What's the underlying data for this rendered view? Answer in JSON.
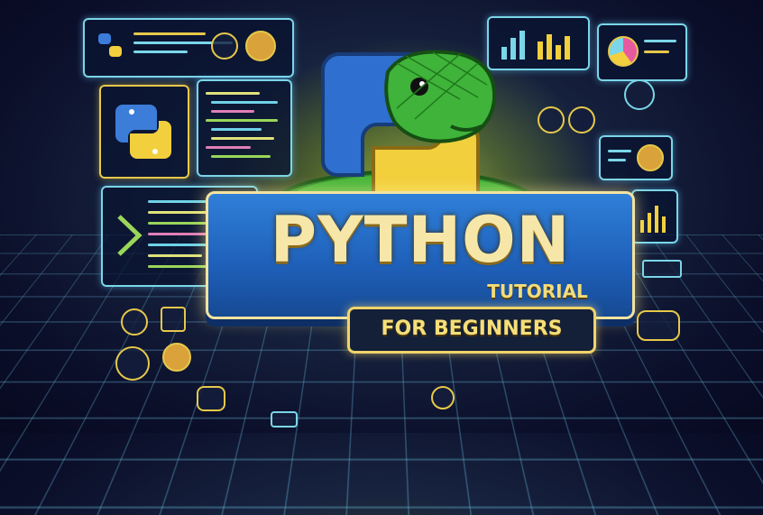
{
  "title": "PYTHON",
  "subtitle": "TUTORIAL",
  "banner": "FOR BEGINNERS",
  "icons": [
    "python-logo-icon",
    "snake-icon",
    "magnifier-icon",
    "bulb-icon",
    "chart-icon",
    "code-icon"
  ],
  "colors": {
    "accent_blue": "#2f7fd8",
    "accent_gold": "#f6e7a9",
    "panel_border": "#7ad6e8",
    "snake_green": "#3fb33a",
    "python_yellow": "#f2cf3c"
  }
}
